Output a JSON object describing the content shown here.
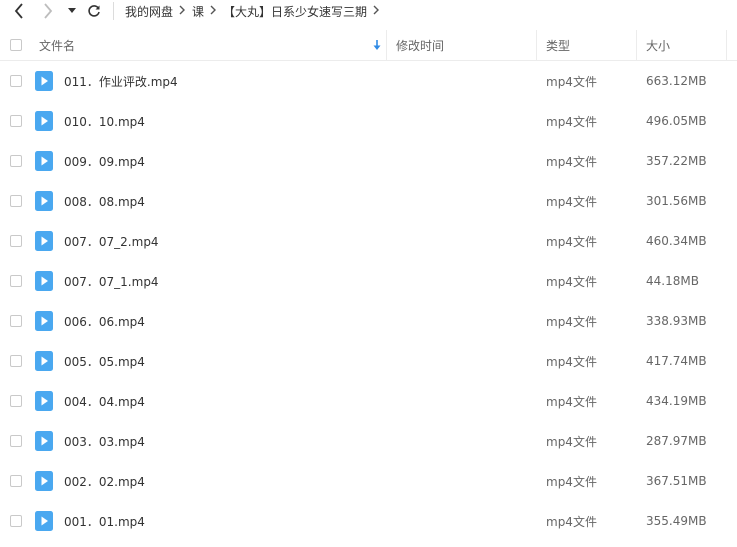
{
  "nav": {
    "back_icon": "chevron-left-icon",
    "forward_icon": "chevron-right-icon",
    "dropdown_icon": "triangle-down-icon",
    "refresh_icon": "refresh-icon"
  },
  "breadcrumb": [
    "我的网盘",
    "课",
    "【大丸】日系少女速写三期"
  ],
  "columns": {
    "name": "文件名",
    "modified": "修改时间",
    "type": "类型",
    "size": "大小",
    "sort_icon": "sort-down-arrow-icon"
  },
  "files": [
    {
      "name": "011．作业评改.mp4",
      "type": "mp4文件",
      "size": "663.12MB"
    },
    {
      "name": "010．10.mp4",
      "type": "mp4文件",
      "size": "496.05MB"
    },
    {
      "name": "009．09.mp4",
      "type": "mp4文件",
      "size": "357.22MB"
    },
    {
      "name": "008．08.mp4",
      "type": "mp4文件",
      "size": "301.56MB"
    },
    {
      "name": "007．07_2.mp4",
      "type": "mp4文件",
      "size": "460.34MB"
    },
    {
      "name": "007．07_1.mp4",
      "type": "mp4文件",
      "size": "44.18MB"
    },
    {
      "name": "006．06.mp4",
      "type": "mp4文件",
      "size": "338.93MB"
    },
    {
      "name": "005．05.mp4",
      "type": "mp4文件",
      "size": "417.74MB"
    },
    {
      "name": "004．04.mp4",
      "type": "mp4文件",
      "size": "434.19MB"
    },
    {
      "name": "003．03.mp4",
      "type": "mp4文件",
      "size": "287.97MB"
    },
    {
      "name": "002．02.mp4",
      "type": "mp4文件",
      "size": "367.51MB"
    },
    {
      "name": "001．01.mp4",
      "type": "mp4文件",
      "size": "355.49MB"
    }
  ],
  "colors": {
    "video_icon": "#4aa8f0",
    "sort_arrow": "#2f8ae5"
  }
}
